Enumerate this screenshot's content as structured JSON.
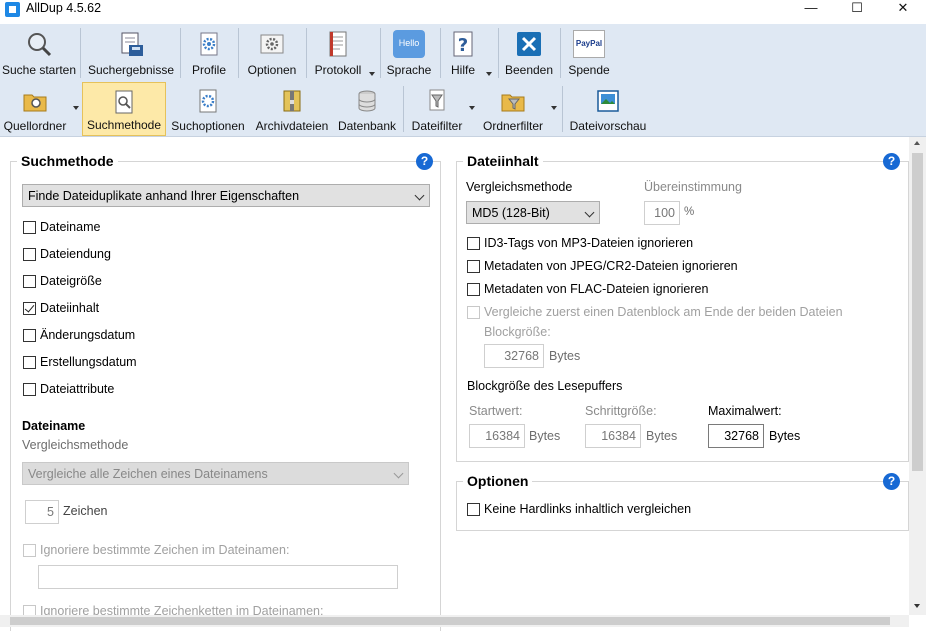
{
  "window": {
    "title": "AllDup 4.5.62",
    "minimize": "—",
    "maximize": "☐",
    "close": "✕"
  },
  "toolbar_main": [
    {
      "label": "Suche starten",
      "icon": "magnifier-icon"
    },
    {
      "label": "Suchergebnisse",
      "icon": "results-printer-icon"
    },
    {
      "label": "Profile",
      "icon": "profile-gear-icon"
    },
    {
      "label": "Optionen",
      "icon": "options-gear-icon"
    },
    {
      "label": "Protokoll",
      "icon": "log-document-icon"
    },
    {
      "label": "Sprache",
      "icon": "hello-speech-icon",
      "badge": "Hello"
    },
    {
      "label": "Hilfe",
      "icon": "question-icon"
    },
    {
      "label": "Beenden",
      "icon": "exit-x-icon"
    },
    {
      "label": "Spende",
      "icon": "paypal-heart-icon",
      "badge": "PayPal"
    }
  ],
  "toolbar_sub": [
    {
      "label": "Quellordner",
      "icon": "source-folder-icon"
    },
    {
      "label": "Suchmethode",
      "icon": "search-method-icon"
    },
    {
      "label": "Suchoptionen",
      "icon": "search-options-icon"
    },
    {
      "label": "Archivdateien",
      "icon": "archive-icon"
    },
    {
      "label": "Datenbank",
      "icon": "database-icon"
    },
    {
      "label": "Dateifilter",
      "icon": "file-filter-icon"
    },
    {
      "label": "Ordnerfilter",
      "icon": "folder-filter-icon"
    },
    {
      "label": "Dateivorschau",
      "icon": "file-preview-icon"
    }
  ],
  "suchmethode": {
    "title": "Suchmethode",
    "help": "?",
    "method": "Finde Dateiduplikate anhand Ihrer Eigenschaften",
    "criteria": [
      {
        "label": "Dateiname",
        "checked": false
      },
      {
        "label": "Dateiendung",
        "checked": false
      },
      {
        "label": "Dateigröße",
        "checked": false
      },
      {
        "label": "Dateiinhalt",
        "checked": true
      },
      {
        "label": "Änderungsdatum",
        "checked": false
      },
      {
        "label": "Erstellungsdatum",
        "checked": false
      },
      {
        "label": "Dateiattribute",
        "checked": false
      }
    ],
    "dateiname": {
      "heading": "Dateiname",
      "compare_label": "Vergleichsmethode",
      "compare_value": "Vergleiche alle Zeichen eines Dateinamens",
      "chars_value": "5",
      "chars_unit": "Zeichen",
      "ignore_chars_label": "Ignoriere bestimmte Zeichen im Dateinamen:",
      "ignore_chars_value": "",
      "ignore_strings_label": "Ignoriere bestimmte Zeichenketten im Dateinamen:"
    }
  },
  "dateiinhalt": {
    "title": "Dateiinhalt",
    "help": "?",
    "compare_label": "Vergleichsmethode",
    "compare_value": "MD5 (128-Bit)",
    "match_label": "Übereinstimmung",
    "match_value": "100",
    "match_unit": "%",
    "options": [
      {
        "label": "ID3-Tags von MP3-Dateien ignorieren",
        "checked": false
      },
      {
        "label": "Metadaten von JPEG/CR2-Dateien ignorieren",
        "checked": false
      },
      {
        "label": "Metadaten von FLAC-Dateien ignorieren",
        "checked": false
      }
    ],
    "block_compare_label": "Vergleiche zuerst einen Datenblock am Ende der beiden Dateien",
    "block_size_label": "Blockgröße:",
    "block_size_value": "32768",
    "block_size_unit": "Bytes",
    "buffer_heading": "Blockgröße des Lesepuffers",
    "start_label": "Startwert:",
    "start_value": "16384",
    "step_label": "Schrittgröße:",
    "step_value": "16384",
    "max_label": "Maximalwert:",
    "max_value": "32768",
    "unit": "Bytes"
  },
  "optionen": {
    "title": "Optionen",
    "help": "?",
    "hardlinks_label": "Keine Hardlinks inhaltlich vergleichen",
    "hardlinks_checked": false
  }
}
